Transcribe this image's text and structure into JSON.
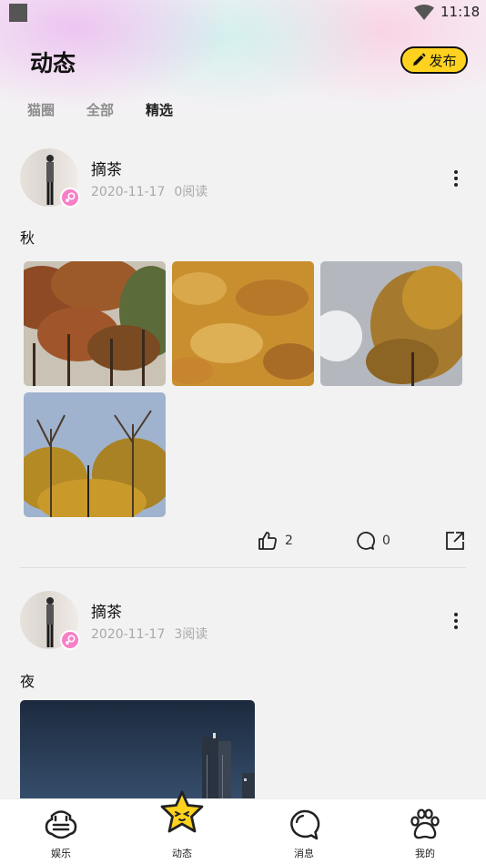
{
  "status_bar": {
    "time": "11:18"
  },
  "header": {
    "title": "动态",
    "post_button_label": "发布"
  },
  "tabs": [
    {
      "label": "猫圈",
      "active": false
    },
    {
      "label": "全部",
      "active": false
    },
    {
      "label": "精选",
      "active": true
    }
  ],
  "posts": [
    {
      "author": "摘茶",
      "date": "2020-11-17",
      "reads": "0阅读",
      "text": "秋",
      "likes": "2",
      "comments": "0",
      "photos": [
        "autumn-red-trees",
        "golden-leaves-ground",
        "ginkgo-tree-sun",
        "ginkgo-trees-sky"
      ]
    },
    {
      "author": "摘茶",
      "date": "2020-11-17",
      "reads": "3阅读",
      "text": "夜",
      "photos": [
        "night-skyscraper"
      ]
    }
  ],
  "bottom_nav": [
    {
      "label": "娱乐",
      "icon": "game-face-icon"
    },
    {
      "label": "动态",
      "icon": "star-icon",
      "active": true
    },
    {
      "label": "消息",
      "icon": "chat-bubble-icon"
    },
    {
      "label": "我的",
      "icon": "paw-icon"
    }
  ],
  "colors": {
    "accent": "#ffd21f",
    "gender_badge": "#f77fc7",
    "muted_text": "#a9a9a9"
  }
}
